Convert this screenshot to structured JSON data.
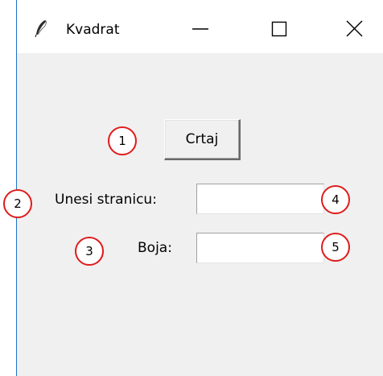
{
  "window": {
    "title": "Kvadrat",
    "app_icon": "feather-icon",
    "controls": [
      "minimize-icon",
      "maximize-icon",
      "close-icon"
    ]
  },
  "form": {
    "draw_button_label": "Crtaj",
    "side_label": "Unesi stranicu:",
    "side_value": "",
    "color_label": "Boja:",
    "color_value": ""
  },
  "markers": {
    "m1": "1",
    "m2": "2",
    "m3": "3",
    "m4": "4",
    "m5": "5"
  },
  "colors": {
    "window_background": "#f0f0f0",
    "titlebar_background": "#ffffff",
    "marker_outline": "#e01b1b",
    "window_border": "#1e73c8"
  }
}
